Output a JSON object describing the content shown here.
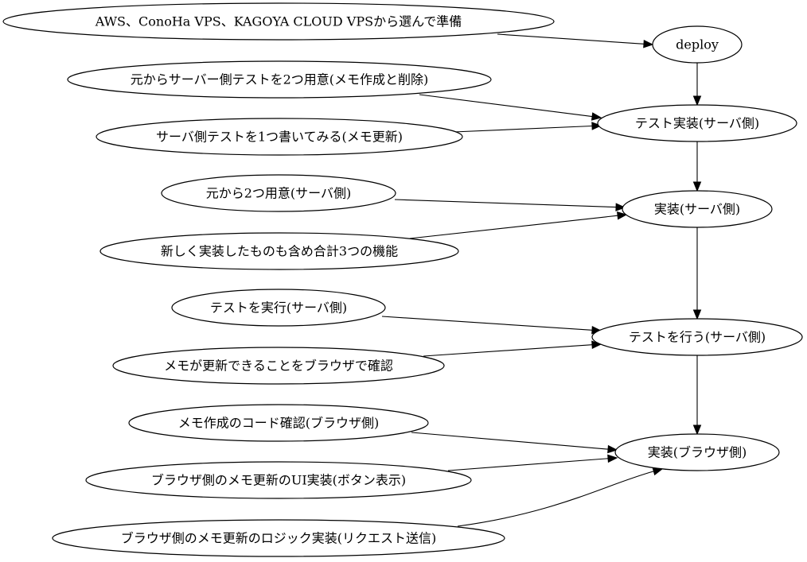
{
  "graph": {
    "nodes": [
      {
        "id": "n_aws",
        "label": "AWS、ConoHa VPS、KAGOYA CLOUD VPSから選んで準備"
      },
      {
        "id": "n_deploy",
        "label": "deploy"
      },
      {
        "id": "n_prep2",
        "label": "元からサーバー側テストを2つ用意(メモ作成と削除)"
      },
      {
        "id": "n_write1",
        "label": "サーバ側テストを1つ書いてみる(メモ更新)"
      },
      {
        "id": "n_test_impl",
        "label": "テスト実装(サーバ側)"
      },
      {
        "id": "n_orig2",
        "label": "元から2つ用意(サーバ側)"
      },
      {
        "id": "n_new3",
        "label": "新しく実装したものも含め合計3つの機能"
      },
      {
        "id": "n_impl_srv",
        "label": "実装(サーバ側)"
      },
      {
        "id": "n_run",
        "label": "テストを実行(サーバ側)"
      },
      {
        "id": "n_browser_check",
        "label": "メモが更新できることをブラウザで確認"
      },
      {
        "id": "n_test_do",
        "label": "テストを行う(サーバ側)"
      },
      {
        "id": "n_code_check",
        "label": "メモ作成のコード確認(ブラウザ側)"
      },
      {
        "id": "n_ui_impl",
        "label": "ブラウザ側のメモ更新のUI実装(ボタン表示)"
      },
      {
        "id": "n_impl_br",
        "label": "実装(ブラウザ側)"
      },
      {
        "id": "n_logic_impl",
        "label": "ブラウザ側のメモ更新のロジック実装(リクエスト送信)"
      }
    ],
    "edges": [
      {
        "from": "n_aws",
        "to": "n_deploy"
      },
      {
        "from": "n_deploy",
        "to": "n_test_impl"
      },
      {
        "from": "n_prep2",
        "to": "n_test_impl"
      },
      {
        "from": "n_write1",
        "to": "n_test_impl"
      },
      {
        "from": "n_test_impl",
        "to": "n_impl_srv"
      },
      {
        "from": "n_orig2",
        "to": "n_impl_srv"
      },
      {
        "from": "n_new3",
        "to": "n_impl_srv"
      },
      {
        "from": "n_impl_srv",
        "to": "n_test_do"
      },
      {
        "from": "n_run",
        "to": "n_test_do"
      },
      {
        "from": "n_browser_check",
        "to": "n_test_do"
      },
      {
        "from": "n_test_do",
        "to": "n_impl_br"
      },
      {
        "from": "n_code_check",
        "to": "n_impl_br"
      },
      {
        "from": "n_ui_impl",
        "to": "n_impl_br"
      },
      {
        "from": "n_logic_impl",
        "to": "n_impl_br"
      }
    ]
  }
}
